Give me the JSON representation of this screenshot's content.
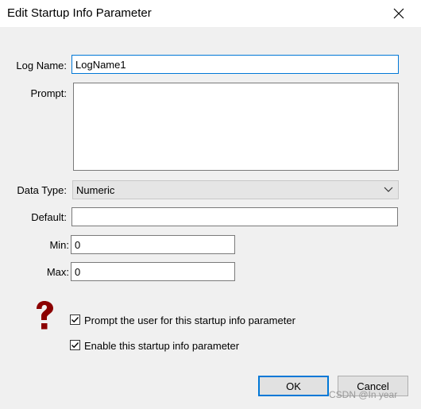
{
  "window": {
    "title": "Edit Startup Info Parameter",
    "close_icon": "close-icon"
  },
  "form": {
    "log_name": {
      "label": "Log Name:",
      "value": "LogName1"
    },
    "prompt": {
      "label": "Prompt:",
      "value": ""
    },
    "data_type": {
      "label": "Data Type:",
      "selected": "Numeric"
    },
    "default": {
      "label": "Default:",
      "value": ""
    },
    "min": {
      "label": "Min:",
      "value": "0"
    },
    "max": {
      "label": "Max:",
      "value": "0"
    }
  },
  "options": {
    "help_icon": "question-mark-icon",
    "prompt_user": {
      "label": "Prompt the user for this startup info parameter",
      "checked": true
    },
    "enable_param": {
      "label": "Enable this startup info parameter",
      "checked": true
    }
  },
  "buttons": {
    "ok": "OK",
    "cancel": "Cancel"
  },
  "watermark": "CSDN @In year",
  "colors": {
    "focus_accent": "#0078d7",
    "help_icon": "#8b0000"
  }
}
